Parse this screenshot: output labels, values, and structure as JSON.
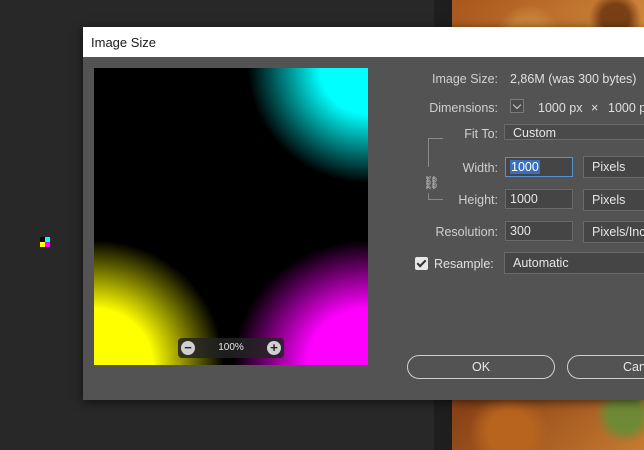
{
  "dialog": {
    "title": "Image Size",
    "zoom_level": "100%",
    "labels": {
      "image_size": "Image Size:",
      "dimensions": "Dimensions:",
      "fit_to": "Fit To:",
      "width": "Width:",
      "height": "Height:",
      "resolution": "Resolution:",
      "resample": "Resample:"
    },
    "values": {
      "image_size": "2,86M (was 300 bytes)",
      "dim_width": "1000 px",
      "dim_times": "×",
      "dim_height": "1000 p",
      "fit_to": "Custom",
      "width": "1000",
      "width_unit": "Pixels",
      "height": "1000",
      "height_unit": "Pixels",
      "resolution": "300",
      "resolution_unit": "Pixels/Inc",
      "resample": "Automatic"
    },
    "resample_checked": true,
    "buttons": {
      "ok": "OK",
      "cancel": "Can"
    }
  },
  "colors": {
    "dialog_bg": "#535353",
    "preview_cyan": "#00ffff",
    "preview_yellow": "#ffff00",
    "preview_magenta": "#ff00ff",
    "selection": "#3a6fbd"
  },
  "icons": {
    "zoom_out": "minus-circle-icon",
    "zoom_in": "plus-circle-icon",
    "constrain": "chain-link-icon",
    "dimensions": "chevron-down-icon",
    "resample": "checkbox-checked-icon"
  }
}
